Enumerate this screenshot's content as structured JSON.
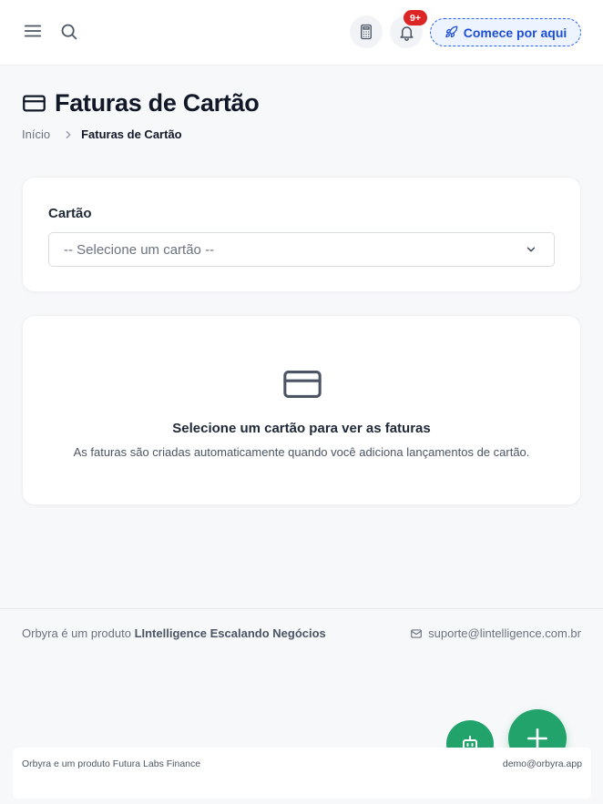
{
  "header": {
    "notification_badge": "9+",
    "start_label": "Comece por aqui"
  },
  "page": {
    "title": "Faturas de Cartão",
    "breadcrumb": {
      "home": "Início",
      "current": "Faturas de Cartão"
    }
  },
  "filter": {
    "label": "Cartão",
    "select_value": "-- Selecione um cartão --"
  },
  "empty_state": {
    "title": "Selecione um cartão para ver as faturas",
    "description": "As faturas são criadas automaticamente quando você adiciona lançamentos de cartão."
  },
  "footer": {
    "prefix": "Orbyra é um produto ",
    "company": "LIntelligence Escalando Negócios",
    "email": "suporte@lintelligence.com.br"
  },
  "bottom_bar": {
    "left_text": "Orbyra e um produto Futura Labs Finance",
    "right_text": "demo@orbyra.app"
  },
  "colors": {
    "accent": "#1d4ed8",
    "fab": "#22a36b",
    "badge": "#dc2626"
  },
  "icons": [
    "menu-icon",
    "search-icon",
    "calculator-icon",
    "bell-icon",
    "rocket-icon",
    "credit-card-icon",
    "chevron-right-icon",
    "chevron-down-icon",
    "mail-icon",
    "robot-icon",
    "plus-icon"
  ]
}
